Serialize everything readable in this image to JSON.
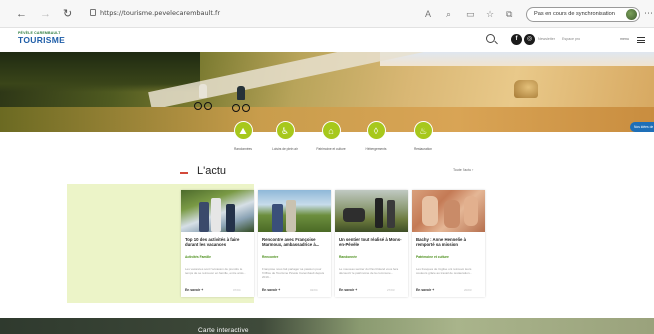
{
  "browser": {
    "url": "https://tourisme.pevelecarembault.fr",
    "sync_label": "Pas en cours de synchronisation"
  },
  "header": {
    "logo_small": "PÉVÈLE CAREMBAULT",
    "logo_main": "TOURISME",
    "logo_sub": "",
    "links": [
      "Newsletter",
      "Espace pro"
    ],
    "menu_label": "menu"
  },
  "hero": {
    "side_button": "Nos idées de"
  },
  "categories": [
    {
      "icon": "hiking-icon",
      "label": "Randonnées"
    },
    {
      "icon": "bike-icon",
      "label": "Loisirs de plein air"
    },
    {
      "icon": "heritage-icon",
      "label": "Patrimoine et culture"
    },
    {
      "icon": "lodging-icon",
      "label": "Hébergements"
    },
    {
      "icon": "restaurant-icon",
      "label": "Restauration"
    }
  ],
  "actu": {
    "title": "L'actu",
    "see_all": "Toute l'actu ›",
    "cards": [
      {
        "title": "Top 10 des activités à faire durant les vacances",
        "tag": "Activités Famille",
        "text": "Les vacances sont l'occasion de prendre le temps de se retrouver en famille, entre amis...",
        "more": "En savoir +",
        "date": "07/04"
      },
      {
        "title": "Rencontre avec Françoise Marmoux, ambassadrice à...",
        "tag": "Rencontre",
        "text": "Françoise nous fait partager sa passion pour l'Office de Tourisme Pévèle Carembault depuis 2019...",
        "more": "En savoir +",
        "date": "02/04"
      },
      {
        "title": "Un sentier tout réalisé à Mons-en-Pévèle",
        "tag": "Randonnée",
        "text": "Le nouveau sentier du Pas Roland vous fera découvrir le patrimoine de la commune...",
        "more": "En savoir +",
        "date": "27/03"
      },
      {
        "title": "Bachy : Anne Hennelie à remporté sa mission",
        "tag": "Patrimoine et culture",
        "text": "Les fresques de l'église ont retrouvé leurs couleurs grâce au travail de restauration...",
        "more": "En savoir +",
        "date": "20/03"
      }
    ]
  },
  "map": {
    "title": "Carte interactive"
  }
}
